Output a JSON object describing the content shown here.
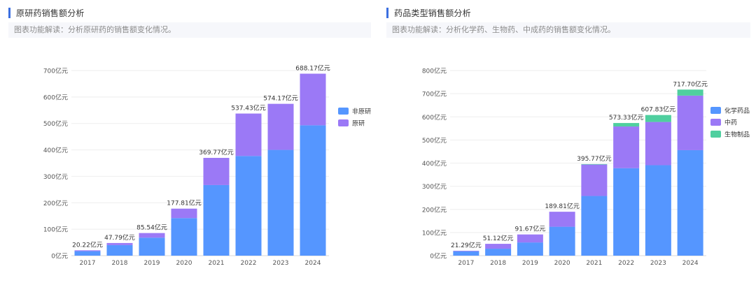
{
  "panels": [
    {
      "title": "原研药销售额分析",
      "description": "图表功能解读：分析原研药的销售额变化情况。"
    },
    {
      "title": "药品类型销售额分析",
      "description": "图表功能解读：分析化学药、生物药、中成药的销售额变化情况。"
    }
  ],
  "chart_data": [
    {
      "type": "bar",
      "stacked": true,
      "categories": [
        "2017",
        "2018",
        "2019",
        "2020",
        "2021",
        "2022",
        "2023",
        "2024"
      ],
      "series": [
        {
          "name": "非原研",
          "color": "#5596ff",
          "values": [
            17.0,
            40.0,
            68.0,
            142.0,
            267.0,
            377.0,
            400.0,
            493.0
          ]
        },
        {
          "name": "原研",
          "color": "#9b79f6",
          "values": [
            3.22,
            7.79,
            17.54,
            35.81,
            102.77,
            160.43,
            174.17,
            195.17
          ]
        }
      ],
      "total_labels": [
        "20.22亿元",
        "47.79亿元",
        "85.54亿元",
        "177.81亿元",
        "369.77亿元",
        "537.43亿元",
        "574.17亿元",
        "688.17亿元"
      ],
      "ylim": [
        0,
        700
      ],
      "yticks": [
        "0亿元",
        "100亿元",
        "200亿元",
        "300亿元",
        "400亿元",
        "500亿元",
        "600亿元",
        "700亿元"
      ],
      "legend_position": "right",
      "grid": true
    },
    {
      "type": "bar",
      "stacked": true,
      "categories": [
        "2017",
        "2018",
        "2019",
        "2020",
        "2021",
        "2022",
        "2023",
        "2024"
      ],
      "series": [
        {
          "name": "化学药品",
          "color": "#5596ff",
          "values": [
            19.0,
            30.0,
            57.0,
            125.0,
            258.0,
            378.0,
            391.0,
            456.0
          ]
        },
        {
          "name": "中药",
          "color": "#9b79f6",
          "values": [
            2.29,
            21.12,
            34.67,
            64.81,
            135.77,
            180.33,
            186.83,
            235.7
          ]
        },
        {
          "name": "生物制品",
          "color": "#4fcf9f",
          "values": [
            0,
            0,
            0,
            0,
            2.0,
            15.0,
            30.0,
            26.0
          ]
        }
      ],
      "total_labels": [
        "21.29亿元",
        "51.12亿元",
        "91.67亿元",
        "189.81亿元",
        "395.77亿元",
        "573.33亿元",
        "607.83亿元",
        "717.70亿元"
      ],
      "ylim": [
        0,
        800
      ],
      "yticks": [
        "0亿元",
        "100亿元",
        "200亿元",
        "300亿元",
        "400亿元",
        "500亿元",
        "600亿元",
        "700亿元",
        "800亿元"
      ],
      "legend_position": "right",
      "grid": true
    }
  ]
}
